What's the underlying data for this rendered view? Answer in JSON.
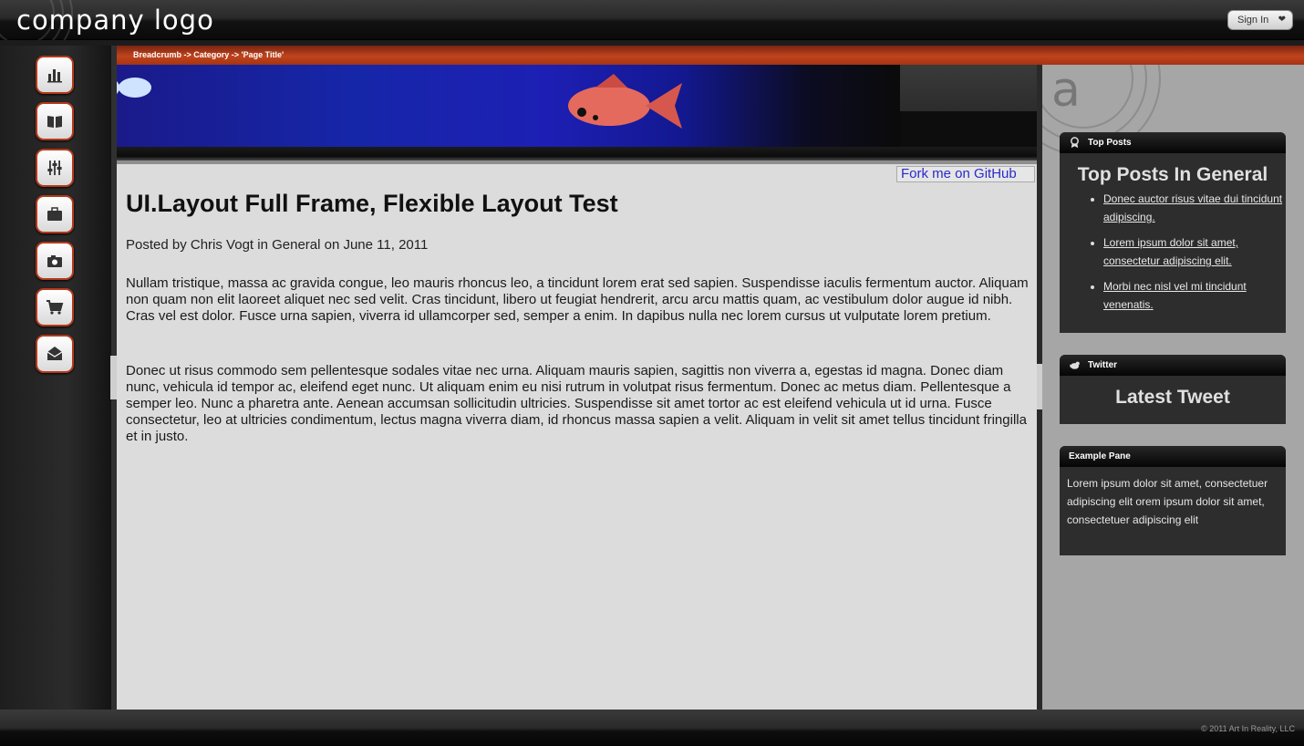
{
  "header": {
    "logo_text": "company logo",
    "signin_label": "Sign In"
  },
  "leftnav": {
    "items": [
      {
        "icon": "bar-chart-icon"
      },
      {
        "icon": "book-icon"
      },
      {
        "icon": "sliders-icon"
      },
      {
        "icon": "briefcase-icon"
      },
      {
        "icon": "camera-icon"
      },
      {
        "icon": "cart-icon"
      },
      {
        "icon": "mail-icon"
      }
    ]
  },
  "breadcrumb": "Breadcrumb -> Category -> 'Page Title'",
  "main": {
    "fork_link": "Fork me on GitHub",
    "title": "UI.Layout Full Frame, Flexible Layout Test",
    "meta": "Posted by Chris Vogt in General on June 11, 2011",
    "paragraphs": [
      "Nullam tristique, massa ac gravida congue, leo mauris rhoncus leo, a tincidunt lorem erat sed sapien. Suspendisse iaculis fermentum auctor. Aliquam non quam non elit laoreet aliquet nec sed velit. Cras tincidunt, libero ut feugiat hendrerit, arcu arcu mattis quam, ac vestibulum dolor augue id nibh. Cras vel est dolor. Fusce urna sapien, viverra id ullamcorper sed, semper a enim. In dapibus nulla nec lorem cursus ut vulputate lorem pretium.",
      "Donec ut risus commodo sem pellentesque sodales vitae nec urna. Aliquam mauris sapien, sagittis non viverra a, egestas id magna. Donec diam nunc, vehicula id tempor ac, eleifend eget nunc. Ut aliquam enim eu nisi rutrum in volutpat risus fermentum. Donec ac metus diam. Pellentesque a semper leo. Nunc a pharetra ante. Aenean accumsan sollicitudin ultricies. Suspendisse sit amet tortor ac est eleifend vehicula ut id urna. Fusce consectetur, leo at ultricies condimentum, lectus magna viverra diam, id rhoncus massa sapien a velit. Aliquam in velit sit amet tellus tincidunt fringilla et in justo."
    ]
  },
  "sidebar": {
    "watermark": "a",
    "top_posts": {
      "header": "Top Posts",
      "title": "Top Posts In General",
      "links": [
        "Donec auctor risus vitae dui tincidunt adipiscing.",
        "Lorem ipsum dolor sit amet, consectetur adipiscing elit.",
        "Morbi nec nisl vel mi tincidunt venenatis."
      ]
    },
    "twitter": {
      "header": "Twitter",
      "title": "Latest Tweet"
    },
    "example": {
      "header": "Example Pane",
      "text": "Lorem ipsum dolor sit amet, consectetuer adipiscing elit orem ipsum dolor sit amet, consectetuer adipiscing elit"
    }
  },
  "footer": {
    "copyright": "© 2011 Art In Reality, LLC"
  },
  "colors": {
    "accent": "#c0441d",
    "nav_border": "#b23a1c",
    "content_bg": "#dcdcdc",
    "sidebar_bg": "#a6a6a6"
  }
}
